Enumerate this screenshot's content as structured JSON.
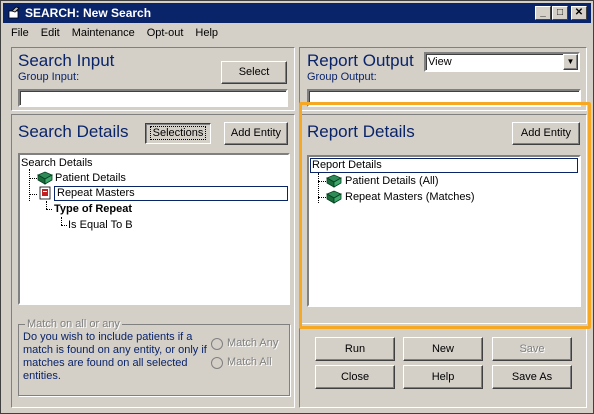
{
  "window": {
    "title": "SEARCH: New Search",
    "buttons": {
      "minimize": "_",
      "maximize": "□",
      "close": "✕"
    }
  },
  "menu": [
    "File",
    "Edit",
    "Maintenance",
    "Opt-out",
    "Help"
  ],
  "search_input": {
    "title": "Search Input",
    "group_label": "Group Input:",
    "group_value": "",
    "select_label": "Select"
  },
  "report_output": {
    "title": "Report Output",
    "dropdown_value": "View",
    "group_label": "Group Output:",
    "group_value": ""
  },
  "search_details": {
    "title": "Search Details",
    "selections_label": "Selections",
    "add_entity_label": "Add Entity",
    "tree": [
      "Search Details",
      "Patient Details",
      "Repeat Masters",
      "Type of Repeat",
      "Is Equal To B"
    ]
  },
  "report_details": {
    "title": "Report Details",
    "add_entity_label": "Add Entity",
    "tree": [
      "Report Details",
      "Patient Details (All)",
      "Repeat Masters (Matches)"
    ]
  },
  "match": {
    "title": "Match on all or any",
    "question": "Do you wish to include patients if a match is found on any entity, or only if matches are found on all selected entities.",
    "options": [
      "Match Any",
      "Match All"
    ]
  },
  "actions": {
    "run": "Run",
    "new": "New",
    "save": "Save",
    "close": "Close",
    "help": "Help",
    "save_as": "Save As"
  },
  "colors": {
    "heading": "#0a246a",
    "highlight": "#f7a823",
    "titlebar": "#0a246a"
  }
}
